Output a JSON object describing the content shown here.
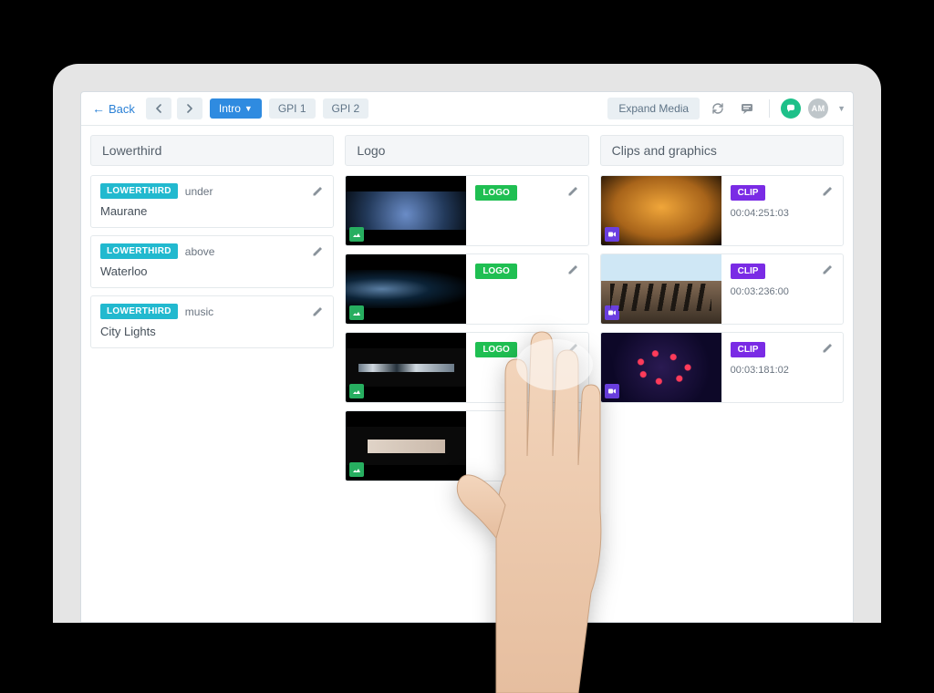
{
  "toolbar": {
    "back_label": "Back",
    "tabs": {
      "intro": "Intro",
      "gpi1": "GPI 1",
      "gpi2": "GPI 2"
    },
    "expand_label": "Expand Media",
    "avatar_initials": "AM"
  },
  "columns": {
    "lowerthird": {
      "title": "Lowerthird",
      "badge": "LOWERTHIRD",
      "items": [
        {
          "variant": "under",
          "title": "Maurane"
        },
        {
          "variant": "above",
          "title": "Waterloo"
        },
        {
          "variant": "music",
          "title": "City Lights"
        }
      ]
    },
    "logo": {
      "title": "Logo",
      "badge": "LOGO",
      "items": [
        {},
        {},
        {},
        {}
      ]
    },
    "clips": {
      "title": "Clips and graphics",
      "badge": "CLIP",
      "items": [
        {
          "timecode": "00:04:251:03"
        },
        {
          "timecode": "00:03:236:00"
        },
        {
          "timecode": "00:03:181:02"
        }
      ]
    }
  }
}
